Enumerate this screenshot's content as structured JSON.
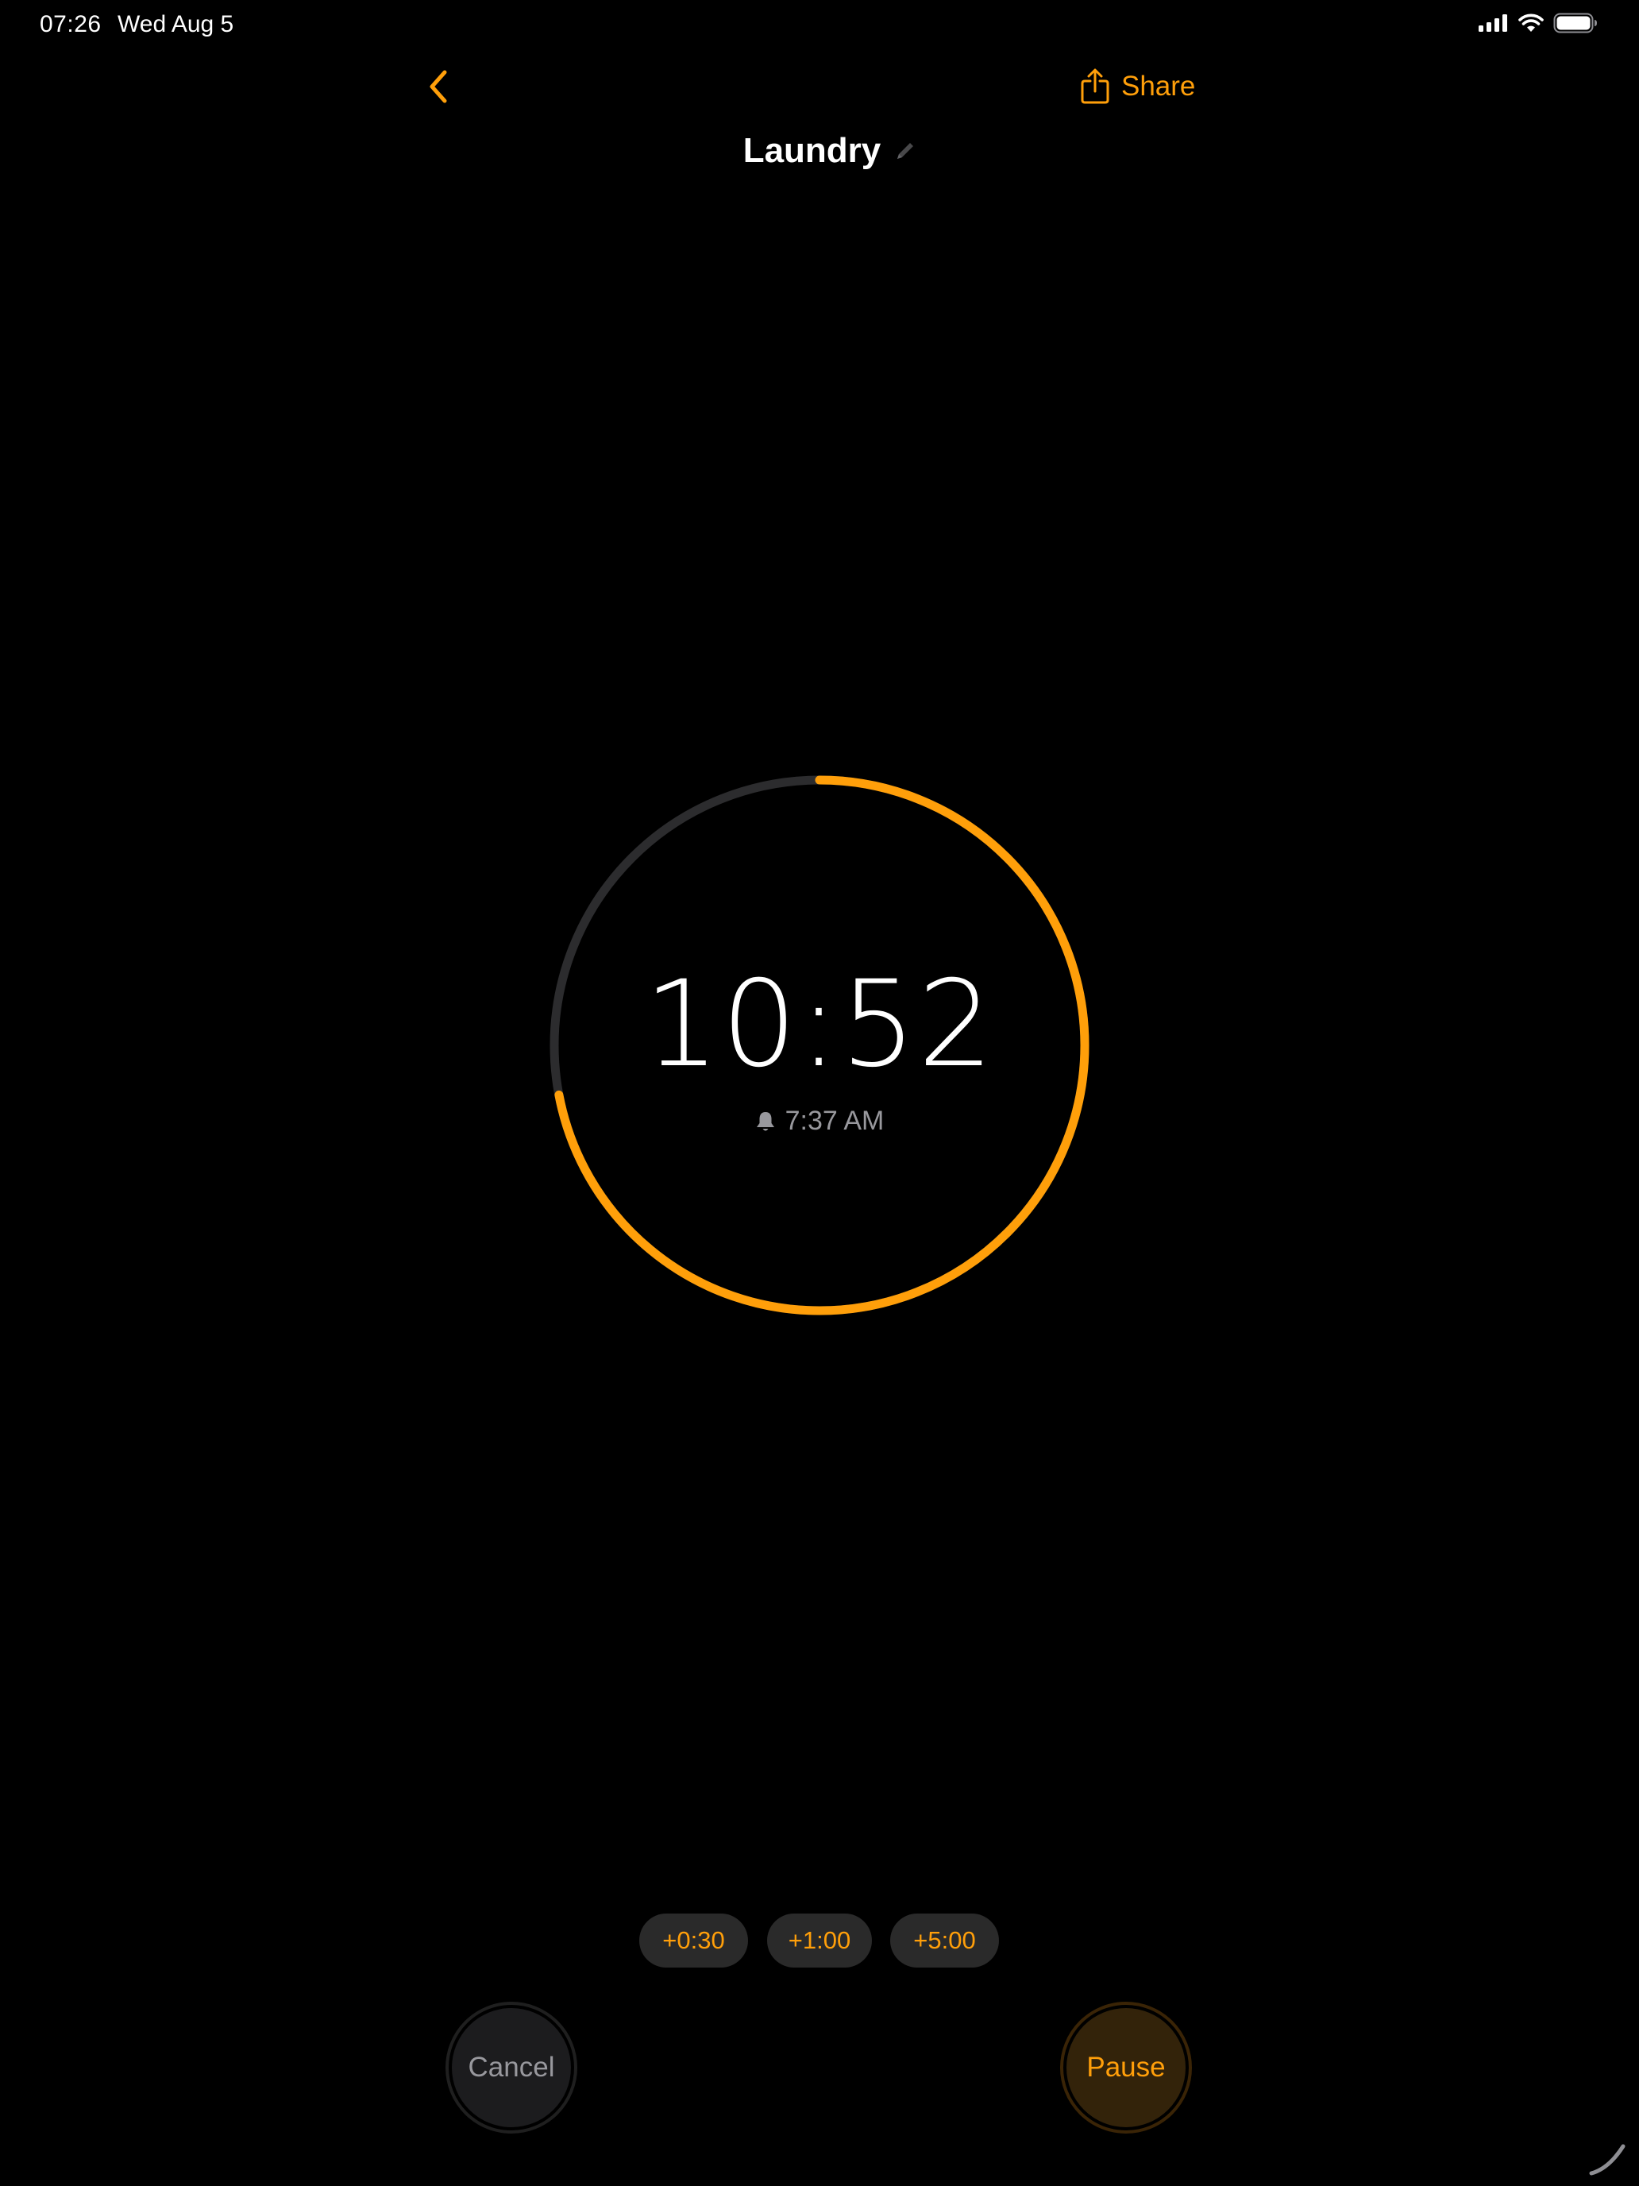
{
  "status_bar": {
    "time": "07:26",
    "date": "Wed Aug 5",
    "icons": [
      "cellular-signal-icon",
      "wifi-icon",
      "battery-icon"
    ]
  },
  "nav": {
    "back_icon": "chevron-left-icon",
    "share_label": "Share",
    "share_icon": "share-icon"
  },
  "timer": {
    "title": "Laundry",
    "edit_icon": "pencil-icon",
    "remaining": "10:52",
    "alarm_icon": "bell-icon",
    "alarm_time": "7:37 AM",
    "progress_remaining_fraction": 0.72
  },
  "quick_add": [
    {
      "label": "+0:30"
    },
    {
      "label": "+1:00"
    },
    {
      "label": "+5:00"
    }
  ],
  "buttons": {
    "cancel_label": "Cancel",
    "pause_label": "Pause"
  },
  "colors": {
    "accent": "#ff9f0a",
    "track": "#2c2c2e",
    "background": "#000000",
    "secondary_text": "#98989d"
  }
}
